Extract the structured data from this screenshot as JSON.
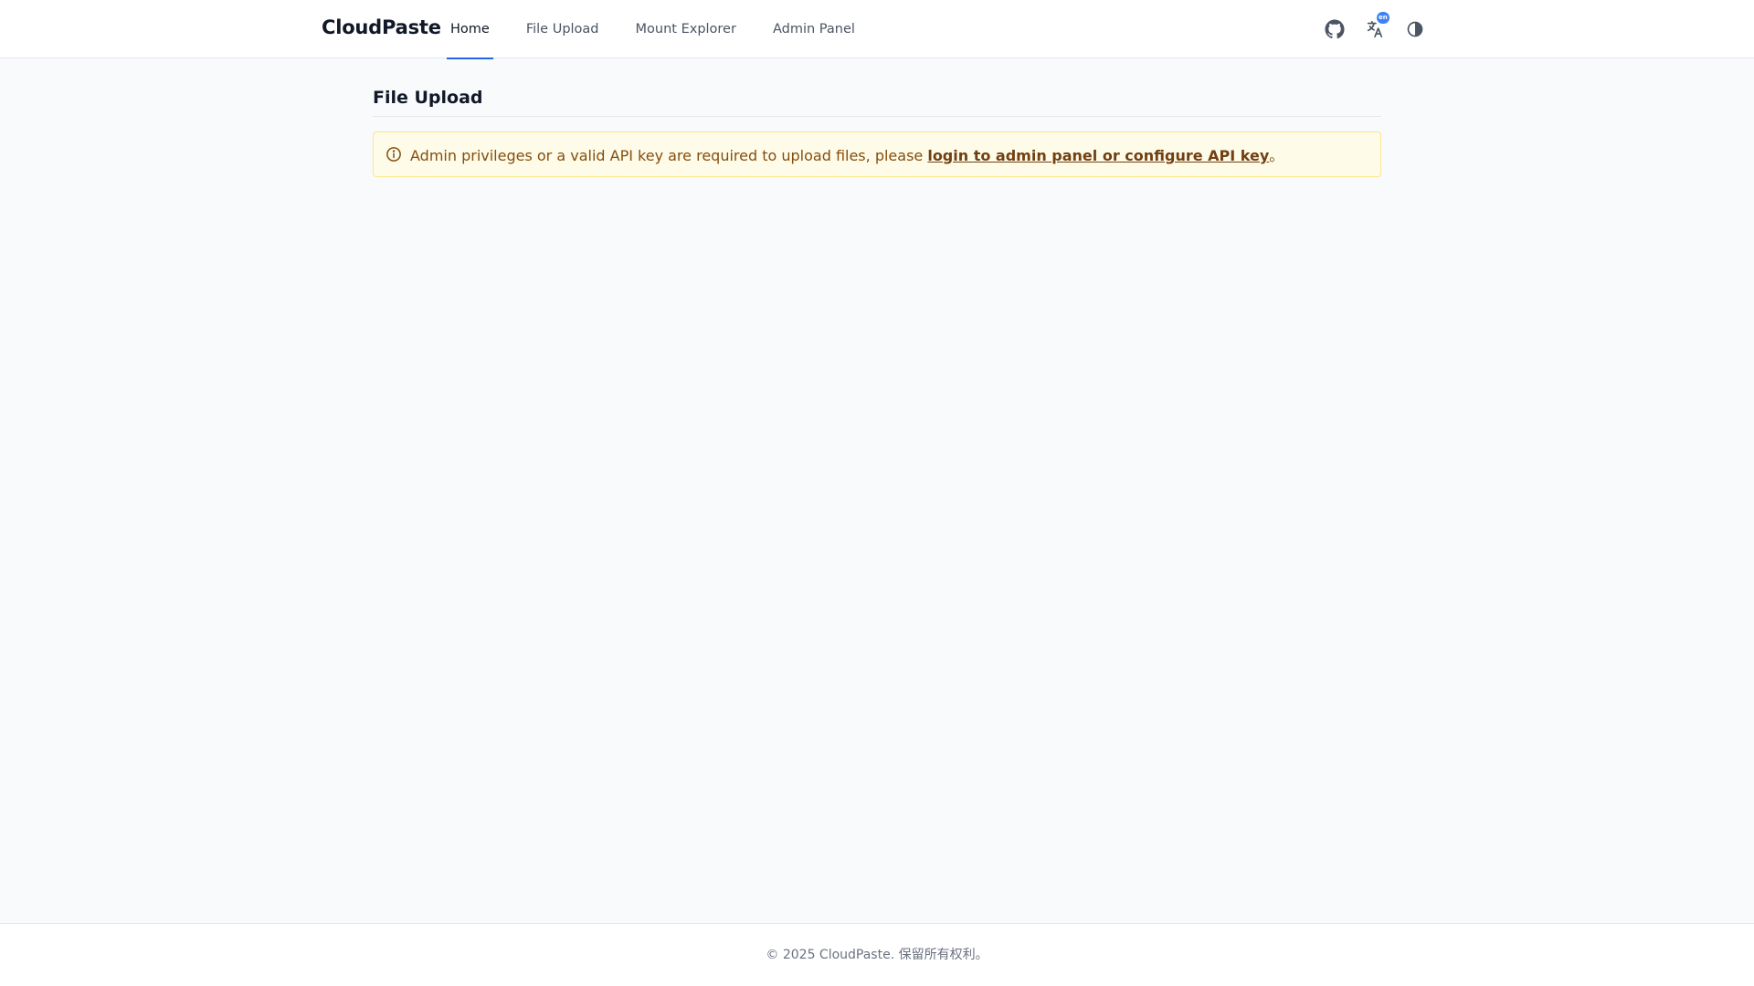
{
  "header": {
    "brand": "CloudPaste",
    "nav": [
      {
        "label": "Home",
        "active": true
      },
      {
        "label": "File Upload",
        "active": false
      },
      {
        "label": "Mount Explorer",
        "active": false
      },
      {
        "label": "Admin Panel",
        "active": false
      }
    ],
    "icons": {
      "github": "github-icon",
      "language": "translate-icon",
      "language_badge": "en",
      "theme": "theme-toggle-icon"
    }
  },
  "main": {
    "title": "File Upload",
    "alert": {
      "icon": "info-icon",
      "text_before": "Admin privileges or a valid API key are required to upload files, please ",
      "link_text": "login to admin panel or configure API key",
      "text_after": "。"
    }
  },
  "footer": {
    "copyright": "© 2025 CloudPaste. 保留所有权利。"
  },
  "colors": {
    "accent": "#2563eb",
    "alert_bg": "#fefce8",
    "alert_border": "#fde68a",
    "alert_text": "#854d0e",
    "page_bg": "#f8fafc"
  }
}
